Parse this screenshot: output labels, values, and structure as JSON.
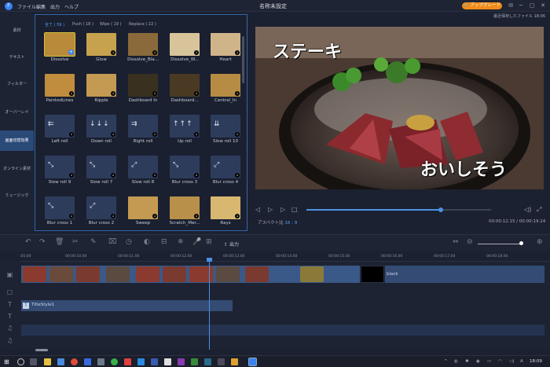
{
  "app": {
    "title": "名称未設定",
    "logo": "F",
    "upgrade_label": "アップグレード",
    "saved_label": "最近保存したファイル 18:06"
  },
  "menu": [
    "ファイル",
    "編集",
    "出力",
    "ヘルプ"
  ],
  "sidebar": [
    {
      "label": "素材",
      "active": false
    },
    {
      "label": "テキスト",
      "active": false
    },
    {
      "label": "フィルター",
      "active": false
    },
    {
      "label": "オーバーレイ",
      "active": false
    },
    {
      "label": "画面切替効果",
      "active": true
    },
    {
      "label": "オンライン素材",
      "active": false
    },
    {
      "label": "ミュージック",
      "active": false
    }
  ],
  "tabs": [
    {
      "label": "全て ( 59 )",
      "active": true
    },
    {
      "label": "Push ( 18 )",
      "active": false
    },
    {
      "label": "Wipe ( 19 )",
      "active": false
    },
    {
      "label": "Replace ( 22 )",
      "active": false
    }
  ],
  "transitions": [
    {
      "label": "Dissolve",
      "color": "#b88a3a",
      "icon": "add-icon"
    },
    {
      "label": "Glow",
      "color": "#c6a24e",
      "icon": "download-icon"
    },
    {
      "label": "Dissolve_Bla...",
      "color": "#8a6a3a",
      "icon": "download-icon"
    },
    {
      "label": "Dissolve_W...",
      "color": "#d8c49a",
      "icon": "download-icon"
    },
    {
      "label": "Heart",
      "color": "#cfb48a",
      "icon": "download-icon"
    },
    {
      "label": "PaintedLines",
      "color": "#c08c3e",
      "icon": "download-icon"
    },
    {
      "label": "Ripple",
      "color": "#c49a52",
      "icon": "download-icon"
    },
    {
      "label": "Dashboard In",
      "color": "#3a3020",
      "icon": "download-icon"
    },
    {
      "label": "Dashboard...",
      "color": "#4a3a24",
      "icon": "download-icon"
    },
    {
      "label": "Central_In",
      "color": "#b68c44",
      "icon": "download-icon"
    },
    {
      "label": "Left roll",
      "color": "#2e3c5c",
      "icon": "download-icon",
      "glyph": "⇇"
    },
    {
      "label": "Down roll",
      "color": "#2e3c5c",
      "icon": "download-icon",
      "glyph": "↓↓↓"
    },
    {
      "label": "Right roll",
      "color": "#2e3c5c",
      "icon": "download-icon",
      "glyph": "⇉"
    },
    {
      "label": "Up roll",
      "color": "#2e3c5c",
      "icon": "download-icon",
      "glyph": "↑↑↑"
    },
    {
      "label": "Slow roll 10",
      "color": "#2e3c5c",
      "icon": "download-icon",
      "glyph": "⇊"
    },
    {
      "label": "Slow roll 9",
      "color": "#2e3c5c",
      "icon": "download-icon",
      "glyph": "⤡"
    },
    {
      "label": "Slow roll 7",
      "color": "#2e3c5c",
      "icon": "download-icon",
      "glyph": "⤡"
    },
    {
      "label": "Slow roll 8",
      "color": "#2e3c5c",
      "icon": "download-icon",
      "glyph": "⤢"
    },
    {
      "label": "Blur cross 3",
      "color": "#2e3c5c",
      "icon": "download-icon",
      "glyph": "⤡"
    },
    {
      "label": "Blur cross 4",
      "color": "#2e3c5c",
      "icon": "download-icon",
      "glyph": "⤢"
    },
    {
      "label": "Blur cross 1",
      "color": "#2e3c5c",
      "icon": "download-icon",
      "glyph": "⤡"
    },
    {
      "label": "Blur cross 2",
      "color": "#2e3c5c",
      "icon": "download-icon",
      "glyph": "⤢"
    },
    {
      "label": "Sweep",
      "color": "#c49a52",
      "icon": "download-icon"
    },
    {
      "label": "Scratch_Mer...",
      "color": "#b8904a",
      "icon": "download-icon"
    },
    {
      "label": "Rays",
      "color": "#d8b870",
      "icon": "download-icon"
    }
  ],
  "preview": {
    "caption_top": "ステーキ",
    "caption_bottom": "おいしそう"
  },
  "player": {
    "aspect_label": "アスペクト比",
    "aspect_value": "16 : 9",
    "time": "00:00:12.15 / 00:00:19.14",
    "progress": 0.72
  },
  "toolbar": {
    "export_label": "出力"
  },
  "ruler": [
    "00:00:10.00",
    "00:00:11.00",
    "00:00:12.00",
    "00:00:13.00",
    "00:00:14.00",
    "00:00:15.00",
    "00:00:16.00",
    "00:00:17.00",
    "00:00:18.00"
  ],
  "ruler_start": ":05:00",
  "timeline": {
    "black_label": "black",
    "title_clip": "TitleStyle1"
  },
  "taskbar": {
    "time": "18:09",
    "lang": "A"
  }
}
